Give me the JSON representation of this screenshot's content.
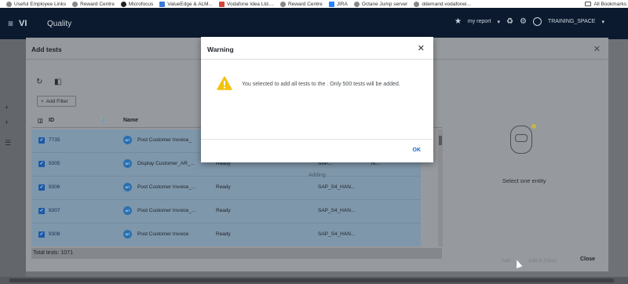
{
  "bookmarks": [
    {
      "label": "Useful Employee Links",
      "icon": "globe-icon"
    },
    {
      "label": "Reward Centre",
      "icon": "globe-icon"
    },
    {
      "label": "Microfocus",
      "icon": "microfocus-icon"
    },
    {
      "label": "ValueEdge & ALM...",
      "icon": "valueedge-icon"
    },
    {
      "label": "Vodafone Idea Ltd....",
      "icon": "gmail-icon"
    },
    {
      "label": "Reward Centre",
      "icon": "globe-icon"
    },
    {
      "label": "JIRA",
      "icon": "jira-icon"
    },
    {
      "label": "Octane Jump server",
      "icon": "globe-icon"
    },
    {
      "label": "ddemand.vodafonei...",
      "icon": "globe-icon"
    }
  ],
  "all_bookmarks": "All Bookmarks",
  "header": {
    "logo": "VI",
    "module": "Quality",
    "my_report": "my report",
    "workspace": "TRAINING_SPACE"
  },
  "add_tests": {
    "title": "Add tests",
    "add_filter": "Add Filter",
    "columns": {
      "id": "ID",
      "name": "Name"
    },
    "rows": [
      {
        "id": "7735",
        "badge": "MT",
        "name": "Post Customer Invoice_",
        "status": "",
        "sap": "",
        "extra": ""
      },
      {
        "id": "9305",
        "badge": "MT",
        "name": "Display Customer_AR_...",
        "status": "Ready",
        "sap": "SAP...",
        "extra": "N..."
      },
      {
        "id": "9306",
        "badge": "MT",
        "name": "Post Customer Invoice_...",
        "status": "Ready",
        "sap": "SAP_S4_HAN...",
        "extra": ""
      },
      {
        "id": "9307",
        "badge": "MT",
        "name": "Post Customer Invoice_...",
        "status": "Ready",
        "sap": "SAP_S4_HAN...",
        "extra": ""
      },
      {
        "id": "9308",
        "badge": "MT",
        "name": "Post Customer Invoice",
        "status": "Ready",
        "sap": "SAP_S4_HAN...",
        "extra": ""
      }
    ],
    "adding": "Adding",
    "total": "Total tests: 1071",
    "empty_panel": "Select one entity",
    "footer": {
      "add": "Add",
      "add_close": "Add & Close",
      "close": "Close"
    }
  },
  "warning": {
    "title": "Warning",
    "message": "You selected to add all tests to the . Only 500 tests will be added.",
    "ok": "OK"
  },
  "colors": {
    "header_bg": "#0b1a2f",
    "selected_row": "#7f97ab",
    "ok_blue": "#1967c6",
    "warning_yellow": "#f4c20d"
  }
}
